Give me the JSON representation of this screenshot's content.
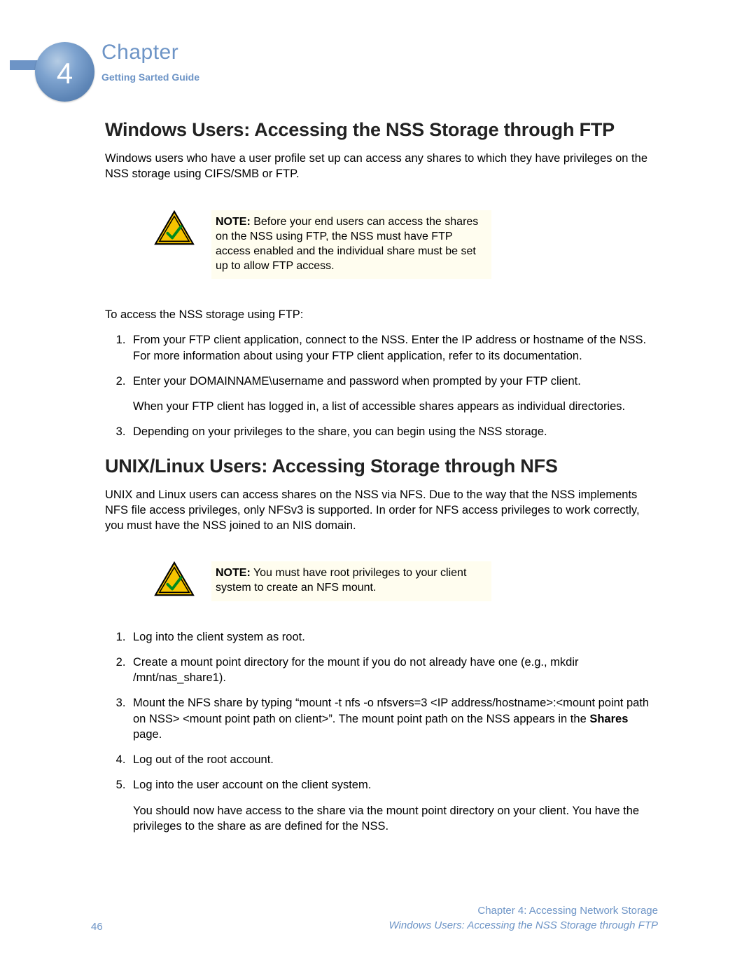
{
  "header": {
    "chapter_number": "4",
    "chapter_word": "Chapter",
    "guide_name": "Getting Sarted Guide"
  },
  "section1": {
    "title": "Windows Users: Accessing the NSS Storage through FTP",
    "intro": "Windows users who have a user profile set up can access any shares to which they have privileges on the NSS storage using CIFS/SMB or FTP.",
    "note_label": "NOTE:",
    "note_body": " Before your end users can access the shares on the NSS using FTP, the NSS must have FTP access enabled and the individual share must be set up to allow FTP access.",
    "lead": "To access the NSS storage using FTP:",
    "steps": [
      "From your FTP client application, connect to the NSS. Enter the IP address or hostname of the NSS. For more information about using your FTP client application, refer to its documentation.",
      "Enter your DOMAINNAME\\username and password when prompted by your FTP client.",
      "Depending on your privileges to the share, you can begin using the NSS storage."
    ],
    "step2_extra": "When your FTP client has logged in, a list of accessible shares appears as individual directories."
  },
  "section2": {
    "title": "UNIX/Linux Users: Accessing Storage through NFS",
    "intro": "UNIX and Linux users can access shares on the NSS via NFS. Due to the way that the NSS implements NFS file access privileges, only NFSv3 is supported. In order for NFS access privileges to work correctly, you must have the NSS joined to an NIS domain.",
    "note_label": "NOTE:",
    "note_body": " You must have root privileges to your client system to create an NFS mount.",
    "steps": [
      "Log into the client system as root.",
      "Create a mount point directory for the mount if you do not already have one (e.g., mkdir /mnt/nas_share1).",
      "Mount the NFS share by typing “mount -t nfs -o nfsvers=3 <IP address/hostname>:<mount point path on NSS> <mount point path on client>”. The mount point path on the NSS appears in the ",
      "Log out of the root account.",
      "Log into the user account on the client system."
    ],
    "step3_bold": "Shares",
    "step3_tail": " page.",
    "step5_extra": "You should now have access to the share via the mount point directory on your client. You have the privileges to the share as are defined for the NSS."
  },
  "footer": {
    "page": "46",
    "chapter": "Chapter 4: Accessing Network Storage",
    "section": "Windows Users: Accessing the NSS Storage through FTP"
  }
}
